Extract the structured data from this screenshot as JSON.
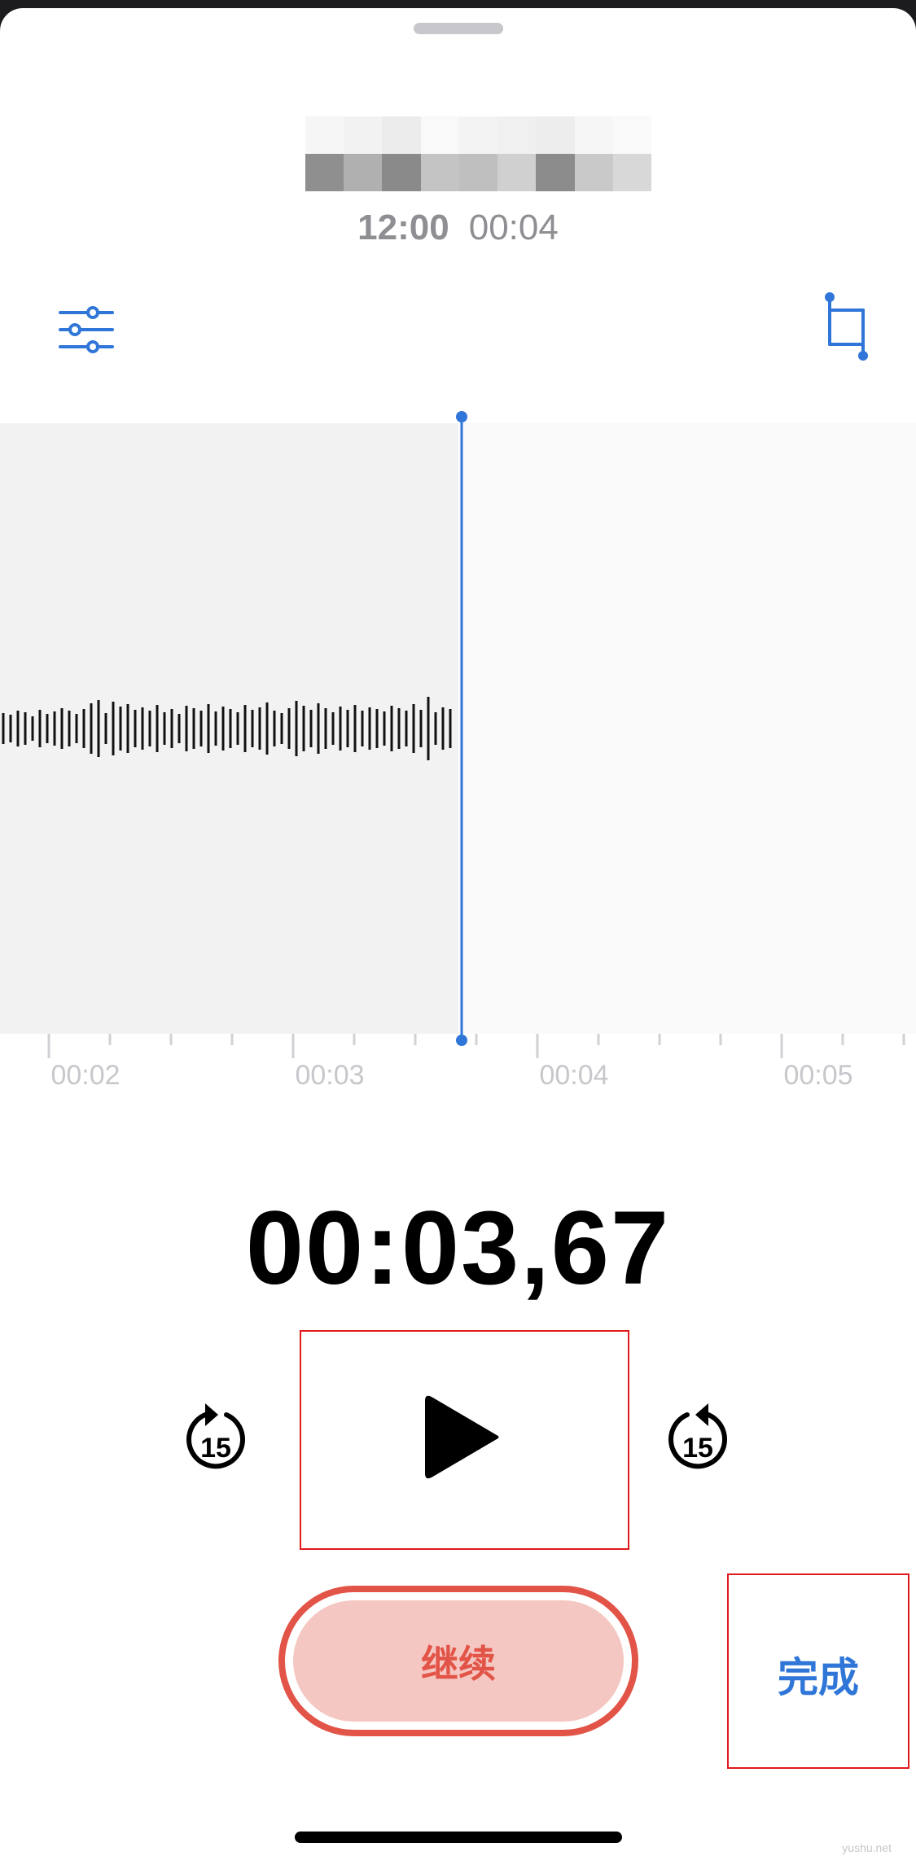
{
  "recording": {
    "clock_time": "12:00",
    "duration": "00:04"
  },
  "icons": {
    "filter": "sliders-icon",
    "trim": "crop-icon",
    "skip_back": "gobackward-15-icon",
    "skip_forward": "goforward-15-icon",
    "play": "play-icon"
  },
  "timeline": {
    "tick_labels": [
      "00:02",
      "00:03",
      "00:04",
      "00:05"
    ]
  },
  "playback": {
    "current_time": "00:03,67",
    "skip_back_label": "15",
    "skip_forward_label": "15"
  },
  "controls": {
    "resume_label": "继续",
    "done_label": "完成"
  },
  "watermark": "yushu.net",
  "colors": {
    "accent": "#2f76d8",
    "record_red": "#e25447",
    "record_fill": "#f5c7c2"
  }
}
